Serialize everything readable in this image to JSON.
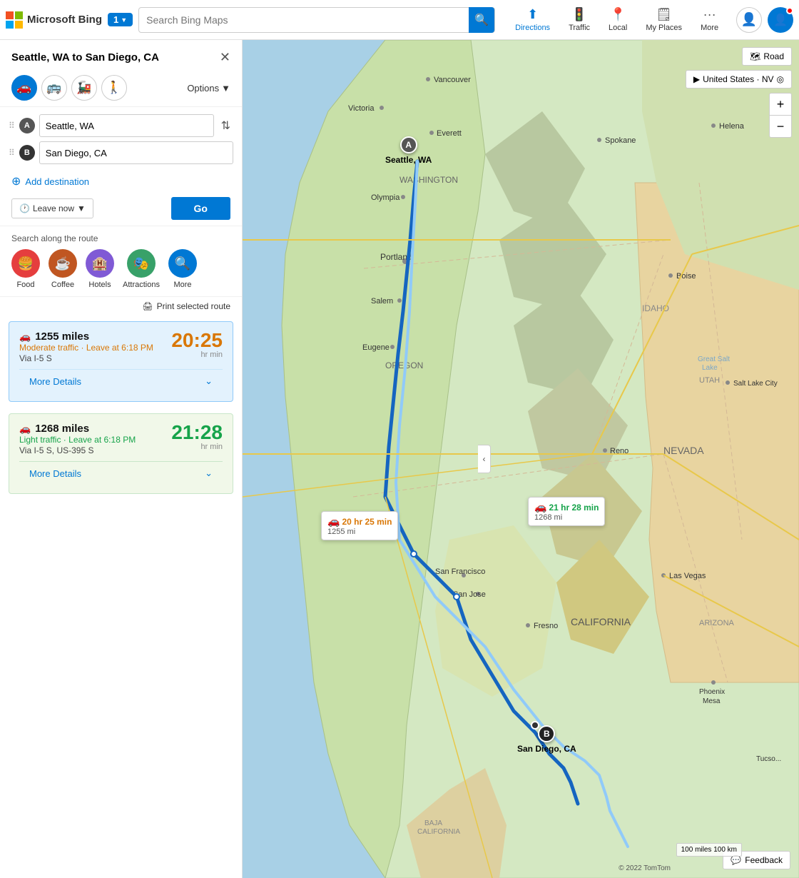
{
  "topnav": {
    "logo_text": "Microsoft Bing",
    "tab_count": "1",
    "search_placeholder": "Search Bing Maps",
    "nav_items": [
      {
        "id": "directions",
        "label": "Directions",
        "icon": "🗺",
        "active": true
      },
      {
        "id": "traffic",
        "label": "Traffic",
        "icon": "🚦",
        "active": false
      },
      {
        "id": "local",
        "label": "Local",
        "icon": "📍",
        "active": false
      },
      {
        "id": "my_places",
        "label": "My Places",
        "icon": "🗒",
        "active": false
      },
      {
        "id": "more",
        "label": "More",
        "icon": "···",
        "active": false
      }
    ],
    "avatar_icon": "👤"
  },
  "sidebar": {
    "title": "Seattle, WA to San Diego, CA",
    "transport_modes": [
      {
        "id": "drive",
        "icon": "🚗",
        "active": true
      },
      {
        "id": "transit",
        "icon": "🚌",
        "active": false
      },
      {
        "id": "train",
        "icon": "🚂",
        "active": false
      },
      {
        "id": "walk",
        "icon": "🚶",
        "active": false
      }
    ],
    "options_label": "Options",
    "origin": "Seattle, WA",
    "destination": "San Diego, CA",
    "add_destination": "Add destination",
    "leave_now": "Leave now",
    "go_label": "Go",
    "search_along_label": "Search along the route",
    "poi_items": [
      {
        "id": "food",
        "label": "Food",
        "icon": "🍔",
        "color_class": "poi-food"
      },
      {
        "id": "coffee",
        "label": "Coffee",
        "icon": "☕",
        "color_class": "poi-coffee"
      },
      {
        "id": "hotels",
        "label": "Hotels",
        "icon": "🏨",
        "color_class": "poi-hotels"
      },
      {
        "id": "attractions",
        "label": "Attractions",
        "icon": "🎭",
        "color_class": "poi-attractions"
      },
      {
        "id": "more",
        "label": "More",
        "icon": "🔍",
        "color_class": "poi-more"
      }
    ],
    "print_label": "Print selected route",
    "routes": [
      {
        "miles": "1255 miles",
        "traffic": "Moderate traffic · Leave at 6:18 PM",
        "traffic_type": "moderate",
        "via": "Via I-5 S",
        "time_hr": "20",
        "time_min": "25",
        "time_unit": "hr min",
        "more_details": "More Details"
      },
      {
        "miles": "1268 miles",
        "traffic": "Light traffic · Leave at 6:18 PM",
        "traffic_type": "light",
        "via": "Via I-5 S, US-395 S",
        "time_hr": "21",
        "time_min": "28",
        "time_unit": "hr min",
        "more_details": "More Details"
      }
    ]
  },
  "map": {
    "road_btn": "Road",
    "region_label": "United States · NV",
    "zoom_in": "+",
    "zoom_out": "−",
    "route1_bubble": {
      "time": "20 hr 25 min",
      "time_color": "orange",
      "miles": "1255 mi"
    },
    "route2_bubble": {
      "time": "21 hr 28 min",
      "time_color": "green",
      "miles": "1268 mi"
    },
    "marker_a_label": "Seattle, WA",
    "marker_b_label": "San Diego, CA",
    "feedback_label": "Feedback",
    "copyright": "© 2022 TomTom",
    "scale_label": "100 miles  100 km"
  },
  "sidebar_collapse_icon": "‹"
}
